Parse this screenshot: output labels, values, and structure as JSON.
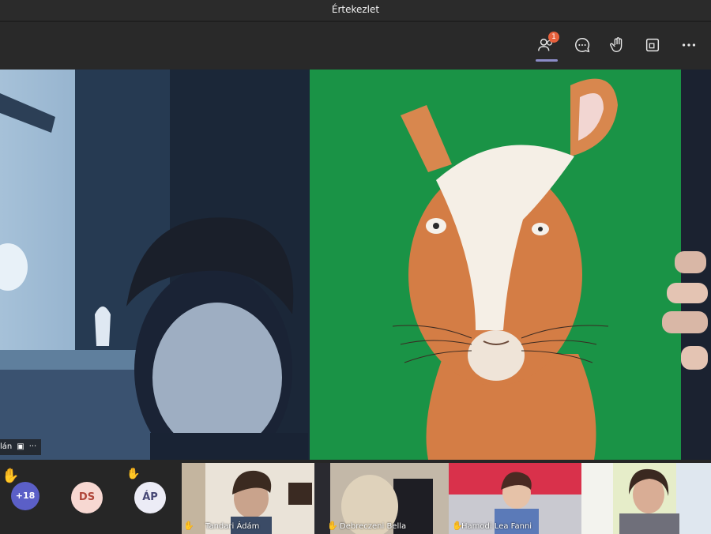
{
  "window": {
    "title": "Értekezlet"
  },
  "toolbar": {
    "participants_badge": "1",
    "buttons": [
      "participants",
      "chat",
      "raise-hand",
      "share",
      "more"
    ]
  },
  "main_stage": {
    "left_participant_name": "lán"
  },
  "bottom_bar": {
    "overflow_count": "+18",
    "avatars": [
      {
        "initials": "DS",
        "bg": "#f7d8d2",
        "fg": "#b0463a"
      },
      {
        "initials": "ÁP",
        "bg": "#ececf6",
        "fg": "#464775"
      }
    ],
    "video_thumbs": [
      {
        "name": "Tandari Ádám"
      },
      {
        "name": "Debreczeni Bella"
      },
      {
        "name": "Hamodi Lea Fanni"
      },
      {
        "name": ""
      }
    ]
  },
  "colors": {
    "accent": "#6264a7",
    "hand": "#f2c12e",
    "background": "#1f1f1f"
  }
}
